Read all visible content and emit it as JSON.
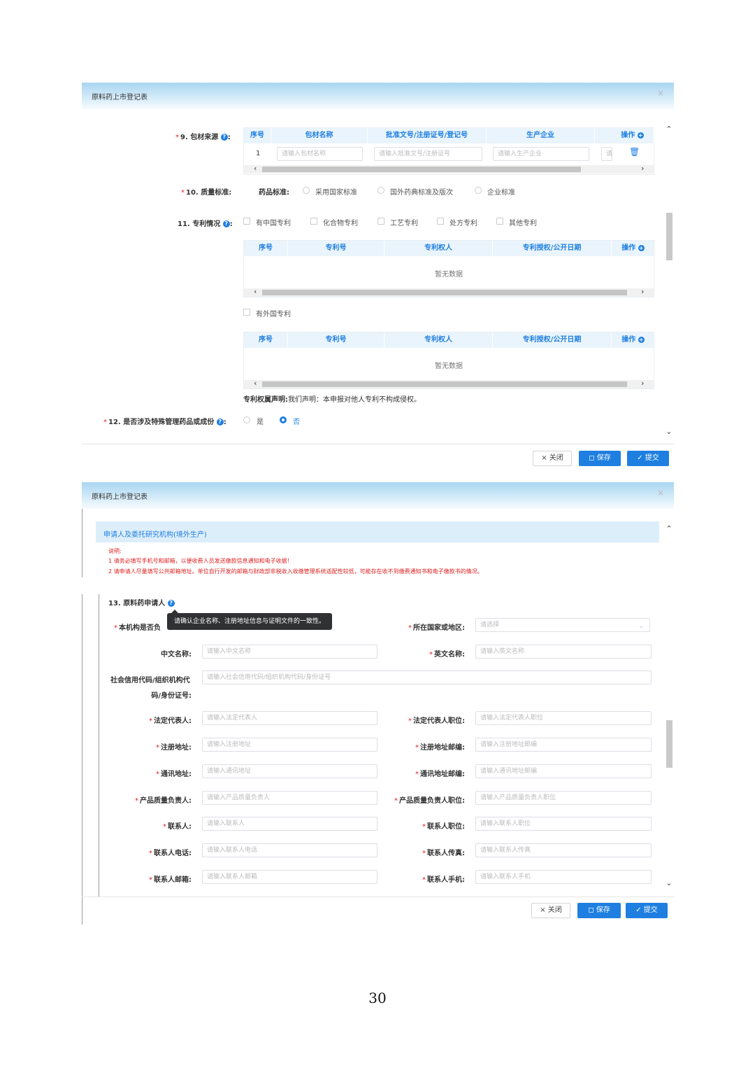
{
  "dialog1": {
    "title": "原料药上市登记表",
    "close_icon": "×",
    "item9": {
      "label": "9. 包材来源",
      "columns": [
        "序号",
        "包材名称",
        "批准文号/注册证号/登记号",
        "生产企业",
        "操作"
      ],
      "row": {
        "index": "1",
        "name_placeholder": "请输入包材名称",
        "approval_placeholder": "请输入批准文号/注册证号",
        "manufacturer_placeholder": "请输入生产企业",
        "extra_placeholder": "请"
      }
    },
    "item10": {
      "label": "10. 质量标准:",
      "sub_label": "药品标准:",
      "options": [
        "采用国家标准",
        "国外药典标准及版次",
        "企业标准"
      ]
    },
    "item11": {
      "label": "11. 专利情况",
      "options": [
        "有中国专利",
        "化合物专利",
        "工艺专利",
        "处方专利",
        "其他专利"
      ],
      "columns": [
        "序号",
        "专利号",
        "专利权人",
        "专利授权/公开日期",
        "操作"
      ],
      "empty_text": "暂无数据",
      "foreign_option": "有外国专利",
      "declaration_label": "专利权属声明:",
      "declaration_text": "我们声明：本申报对他人专利不构成侵权。"
    },
    "item12": {
      "label": "12. 是否涉及特殊管理药品或成份",
      "options": [
        "是",
        "否"
      ],
      "selected": "否"
    },
    "buttons": {
      "close": "× 关闭",
      "save": "保存",
      "submit": "提交"
    }
  },
  "dialog2": {
    "title": "原料药上市登记表",
    "close_icon": "×",
    "section_title": "申请人及委托研究机构(境外生产)",
    "notice": {
      "heading": "说明:",
      "line1": "1 请务必填写手机号和邮箱，以便收费人员发送缴款信息通知和电子收据！",
      "line2": "2 请申请人尽量填写公共邮箱地址。单位自行开发的邮箱与财政部非税收入收缴管理系统适配性较低，可能存在收不到缴费通知书和电子缴款书的情况。"
    },
    "item13_label": "13. 原料药申请人",
    "tooltip": "请确认企业名称、注册地址信息与证明文件的一致性。",
    "field_is_org": "本机构是否负",
    "country_label": "所在国家或地区:",
    "country_placeholder": "请选择",
    "fields": {
      "cn_name": {
        "label": "中文名称:",
        "placeholder": "请输入中文名称"
      },
      "en_name": {
        "label": "英文名称:",
        "placeholder": "请输入英文名称"
      },
      "credit_code": {
        "label1": "社会信用代码/组织机构代",
        "label2": "码/身份证号:",
        "placeholder": "请输入社会信用代码/组织机构代码/身份证号"
      },
      "legal_rep": {
        "label": "法定代表人:",
        "placeholder": "请输入法定代表人"
      },
      "legal_rep_pos": {
        "label": "法定代表人职位:",
        "placeholder": "请输入法定代表人职位"
      },
      "reg_addr": {
        "label": "注册地址:",
        "placeholder": "请输入注册地址"
      },
      "reg_zip": {
        "label": "注册地址邮编:",
        "placeholder": "请输入注册地址邮编"
      },
      "mail_addr": {
        "label": "通讯地址:",
        "placeholder": "请输入通讯地址"
      },
      "mail_zip": {
        "label": "通讯地址邮编:",
        "placeholder": "请输入通讯地址邮编"
      },
      "qa_person": {
        "label": "产品质量负责人:",
        "placeholder": "请输入产品质量负责人"
      },
      "qa_pos": {
        "label": "产品质量负责人职位:",
        "placeholder": "请输入产品质量负责人职位"
      },
      "contact": {
        "label": "联系人:",
        "placeholder": "请输入联系人"
      },
      "contact_pos": {
        "label": "联系人职位:",
        "placeholder": "请输入联系人职位"
      },
      "contact_tel": {
        "label": "联系人电话:",
        "placeholder": "请输入联系人电话"
      },
      "contact_fax": {
        "label": "联系人传真:",
        "placeholder": "请输入联系人传真"
      },
      "contact_email": {
        "label": "联系人邮箱:",
        "placeholder": "请输入联系人邮箱"
      },
      "contact_mobile": {
        "label": "联系人手机:",
        "placeholder": "请输入联系人手机"
      }
    },
    "buttons": {
      "close": "× 关闭",
      "save": "保存",
      "submit": "提交"
    }
  },
  "page_number": "30",
  "colors": {
    "accent": "#1e7fe0",
    "required": "#e02020",
    "header_bg": "#a9d6f2"
  },
  "icons": [
    "help-icon",
    "add-icon",
    "delete-icon",
    "save-icon",
    "check-icon",
    "close-icon",
    "chevron-down-icon"
  ]
}
